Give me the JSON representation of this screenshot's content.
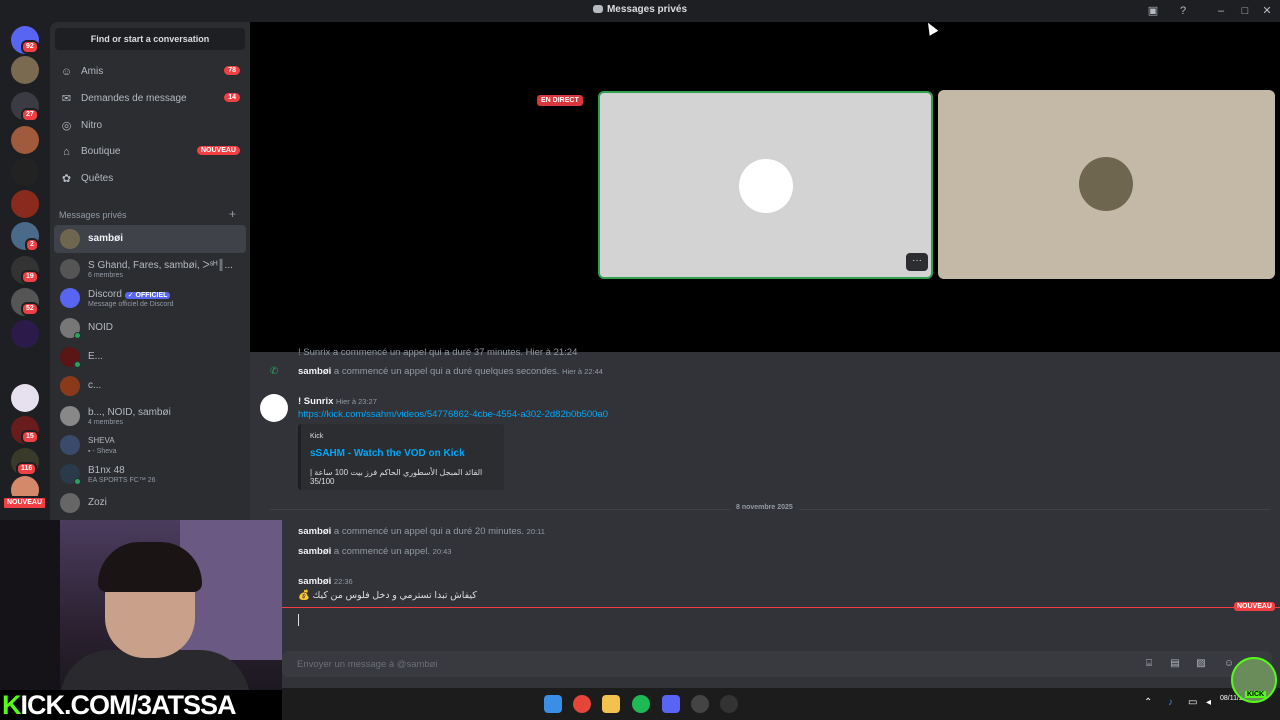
{
  "window": {
    "title": "Messages privés",
    "title_icon": "discord-dm-icon"
  },
  "rail": {
    "home_badge": "92",
    "servers": [
      {
        "icon": "avatar-green-icon",
        "badge": ""
      },
      {
        "icon": "server-27-icon",
        "badge": "27"
      },
      {
        "icon": "kick-server-icon",
        "badge": ""
      },
      {
        "icon": "server-dark-icon",
        "badge": ""
      },
      {
        "icon": "server-red-icon",
        "badge": ""
      },
      {
        "icon": "server-2-icon",
        "badge": "2"
      },
      {
        "icon": "server-19-icon",
        "badge": "19"
      },
      {
        "icon": "server-52-icon",
        "badge": "52"
      },
      {
        "icon": "server-purple-icon",
        "badge": ""
      },
      {
        "icon": "server-blue-icon",
        "badge": ""
      },
      {
        "icon": "valorant-icon",
        "badge": ""
      },
      {
        "icon": "server-15-icon",
        "badge": "15"
      },
      {
        "icon": "server-116-icon",
        "badge": "116"
      },
      {
        "icon": "server-new-icon",
        "badge": "NOUVEAU"
      }
    ]
  },
  "sidebar": {
    "find_button": "Find or start a conversation",
    "nav": [
      {
        "label": "Amis",
        "icon": "friends-icon",
        "badge": "78"
      },
      {
        "label": "Demandes de message",
        "icon": "mail-icon",
        "badge": "14"
      },
      {
        "label": "Nitro",
        "icon": "nitro-icon",
        "badge": ""
      },
      {
        "label": "Boutique",
        "icon": "shop-icon",
        "badge": "NOUVEAU"
      },
      {
        "label": "Quêtes",
        "icon": "quests-icon",
        "badge": ""
      }
    ],
    "dm_header": "Messages privés",
    "dm_add": "+",
    "dms": [
      {
        "name": "sambøi",
        "sub": "",
        "active": true
      },
      {
        "name": "S Ghand, Fares, sambøi, ᐳˢᴴ║...",
        "sub": "6 membres",
        "active": false
      },
      {
        "name": "Discord",
        "badge": "✓ OFFICIEL",
        "sub": "Message officiel de Discord",
        "active": false
      },
      {
        "name": "NOID",
        "sub": "",
        "active": false
      },
      {
        "name": "E...",
        "sub": "",
        "active": false
      },
      {
        "name": "c...",
        "sub": "",
        "active": false
      },
      {
        "name": "b..., NOID, sambøi",
        "sub": "4 membres",
        "active": false
      },
      {
        "name": "SHEVA",
        "sub": "▪ - Sheva",
        "active": false
      },
      {
        "name": "B1nx 48",
        "sub": "EA SPORTS FC™ 26",
        "active": false
      },
      {
        "name": "Zozi",
        "sub": "",
        "active": false
      }
    ]
  },
  "call": {
    "live_label": "EN DIRECT",
    "more_label": "···"
  },
  "chat": {
    "top_partial": "! Sunrix a commencé un appel qui a duré 37 minutes. Hier à 21:24",
    "messages": [
      {
        "user": "sambøi",
        "text": "a commencé un appel qui a duré quelques secondes.",
        "time": "Hier à 22:44"
      },
      {
        "user": "! Sunrix",
        "time": "Hier à 23:27"
      }
    ],
    "link": "https://kick.com/ssahm/videos/54776862-4cbe-4554-a302-2d82b0b500a0",
    "embed": {
      "provider": "Kick",
      "title": "sSAHM - Watch the VOD on Kick",
      "desc": "القائد المبجل الأسطوري الحاكم فرز بيت 100 ساعة | 35/100"
    },
    "date_sep": "8 novembre 2025",
    "later": [
      {
        "user": "sambøi",
        "text": "a commencé un appel qui a duré 20 minutes.",
        "time": "20:11"
      },
      {
        "user": "sambøi",
        "text": "a commencé un appel.",
        "time": "20:43"
      },
      {
        "user": "sambøi",
        "time": "22:36",
        "text": "💰 كيفاش تبدا تسترمي و دخل فلوس من كيك"
      }
    ],
    "new_label": "NOUVEAU",
    "composer_placeholder": "Envoyer un message à @sambøi"
  },
  "overlay": {
    "kick_prefix": "K",
    "kick_text": "ICK.COM/3ATSSA",
    "streamer_tag": "KICK"
  },
  "taskbar": {
    "date": "08/11/2025",
    "apps": [
      "windows-start-icon",
      "chrome-icon",
      "file-explorer-icon",
      "spotify-icon",
      "discord-icon",
      "media-player-icon",
      "recording-icon"
    ]
  },
  "colors": {
    "accent": "#5865f2",
    "danger": "#f23f43",
    "link": "#00a8fc",
    "kick_green": "#53fc18"
  }
}
